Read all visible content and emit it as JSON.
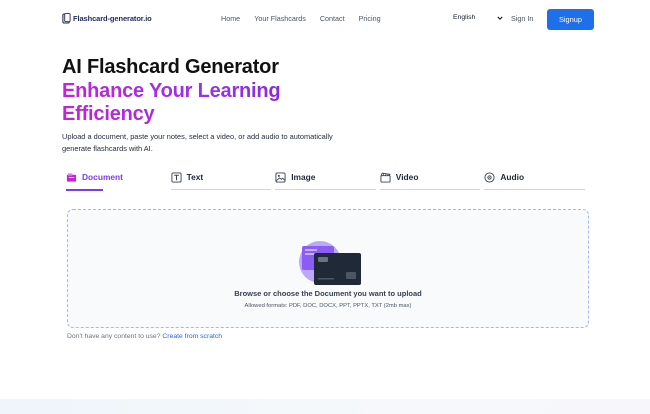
{
  "header": {
    "logo_text": "Flashcard-generator.io",
    "nav": [
      {
        "label": "Home"
      },
      {
        "label": "Your Flashcards"
      },
      {
        "label": "Contact"
      },
      {
        "label": "Pricing"
      }
    ],
    "language": "English",
    "signin_label": "Sign In",
    "signup_label": "Signup"
  },
  "hero": {
    "title": "AI Flashcard Generator",
    "subtitle": "Enhance Your Learning Efficiency",
    "description": "Upload a document, paste your notes, select a video, or add audio to automatically generate flashcards with AI."
  },
  "tabs": [
    {
      "label": "Document",
      "icon": "document-icon",
      "active": true
    },
    {
      "label": "Text",
      "icon": "text-icon",
      "active": false
    },
    {
      "label": "Image",
      "icon": "image-icon",
      "active": false
    },
    {
      "label": "Video",
      "icon": "video-icon",
      "active": false
    },
    {
      "label": "Audio",
      "icon": "audio-icon",
      "active": false
    }
  ],
  "upload": {
    "title": "Browse or choose the Document you want to upload",
    "formats": "Allowed formats: PDF, DOC, DOCX, PPT, PPTX, TXT (2mb max)"
  },
  "scratch": {
    "prompt": "Don't have any content to use?",
    "link": "Create from scratch"
  },
  "colors": {
    "accent": "#7c3aed",
    "primary_button": "#1f6feb",
    "link": "#2563eb"
  }
}
